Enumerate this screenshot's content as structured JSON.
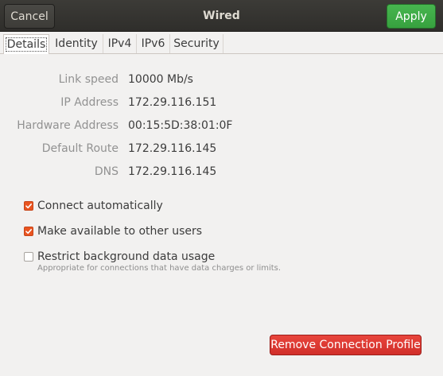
{
  "header": {
    "title": "Wired",
    "cancel_label": "Cancel",
    "apply_label": "Apply"
  },
  "tabs": [
    {
      "label": "Details",
      "active": true
    },
    {
      "label": "Identity",
      "active": false
    },
    {
      "label": "IPv4",
      "active": false
    },
    {
      "label": "IPv6",
      "active": false
    },
    {
      "label": "Security",
      "active": false
    }
  ],
  "details": [
    {
      "label": "Link speed",
      "value": "10000 Mb/s"
    },
    {
      "label": "IP Address",
      "value": "172.29.116.151"
    },
    {
      "label": "Hardware Address",
      "value": "00:15:5D:38:01:0F"
    },
    {
      "label": "Default Route",
      "value": "172.29.116.145"
    },
    {
      "label": "DNS",
      "value": "172.29.116.145"
    }
  ],
  "options": {
    "connect_automatically": {
      "label": "Connect automatically",
      "checked": true
    },
    "available_to_others": {
      "label": "Make available to other users",
      "checked": true
    },
    "restrict_background": {
      "label": "Restrict background data usage",
      "checked": false,
      "description": "Appropriate for connections that have data charges or limits."
    }
  },
  "remove_label": "Remove Connection Profile",
  "colors": {
    "accent": "#e95420",
    "apply": "#3eab46",
    "destructive": "#dc3b33",
    "headerbar": "#35342f"
  }
}
